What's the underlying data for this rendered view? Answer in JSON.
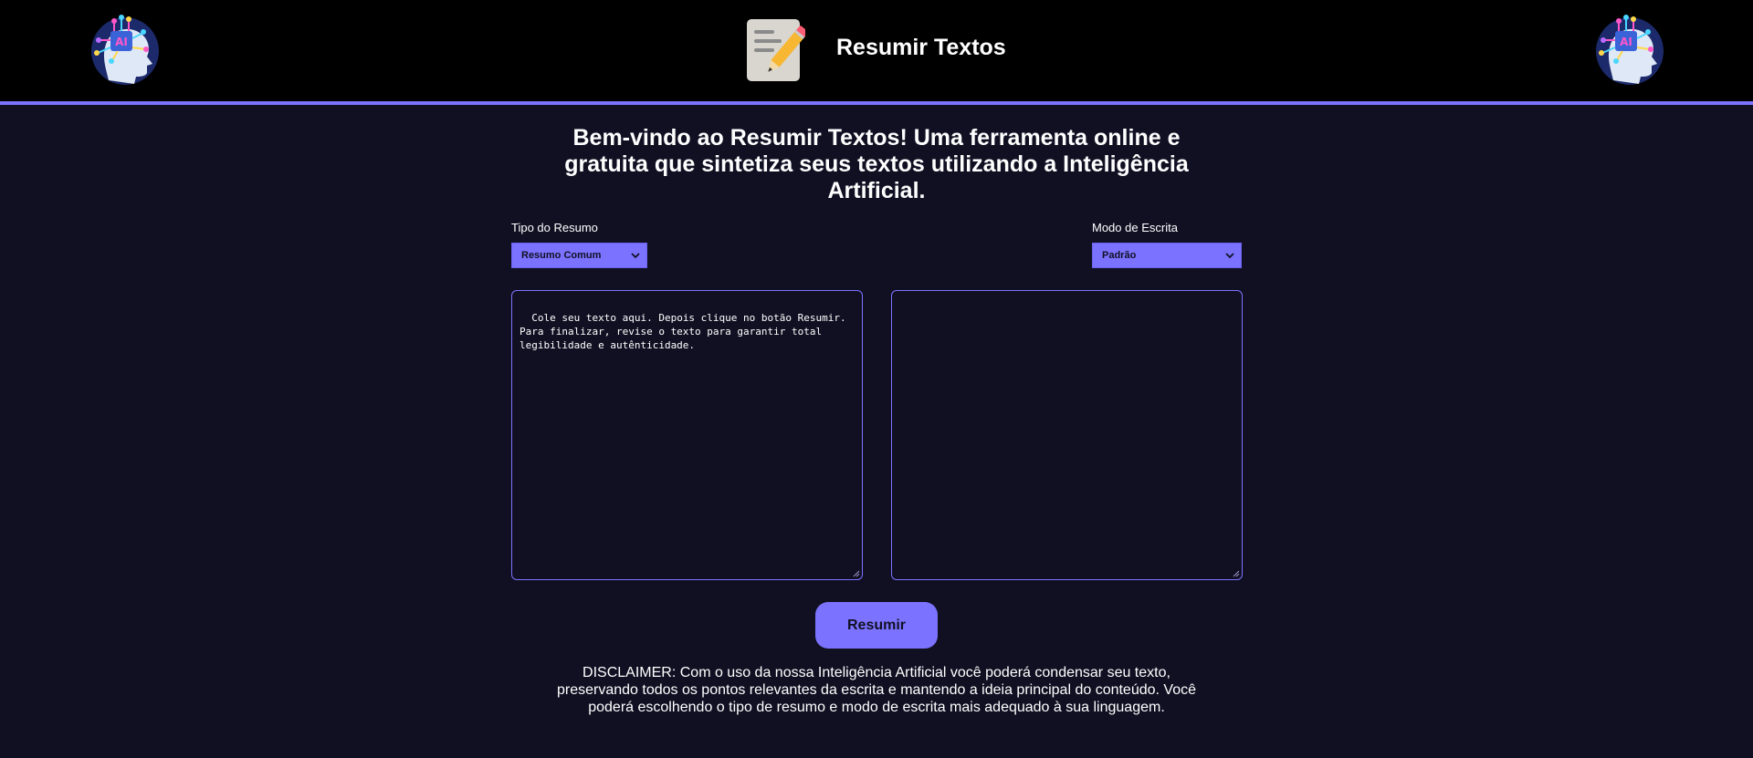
{
  "header": {
    "title": "Resumir Textos",
    "left_logo_icon": "ai-head-icon",
    "right_logo_icon": "ai-head-icon",
    "app_icon": "document-pencil-icon"
  },
  "main": {
    "welcome": "Bem-vindo ao Resumir Textos! Uma ferramenta online e gratuita que sintetiza seus textos utilizando a Inteligência Artificial.",
    "summary_type": {
      "label": "Tipo do Resumo",
      "selected": "Resumo Comum"
    },
    "writing_mode": {
      "label": "Modo de Escrita",
      "selected": "Padrão"
    },
    "input_text": {
      "placeholder": "Cole seu texto aqui. Depois clique no botão Resumir. Para finalizar, revise o texto para garantir total legibilidade e autênticidade."
    },
    "output_text": {
      "value": ""
    },
    "summarize_button": "Resumir",
    "disclaimer": "DISCLAIMER: Com o uso da nossa Inteligência Artificial você poderá condensar seu texto, preservando todos os pontos relevantes da escrita e mantendo a ideia principal do conteúdo. Você poderá escolhendo o tipo de resumo e modo de escrita mais adequado à sua linguagem."
  },
  "colors": {
    "accent": "#7b73ff",
    "background": "#111023",
    "header_background": "#000000"
  }
}
